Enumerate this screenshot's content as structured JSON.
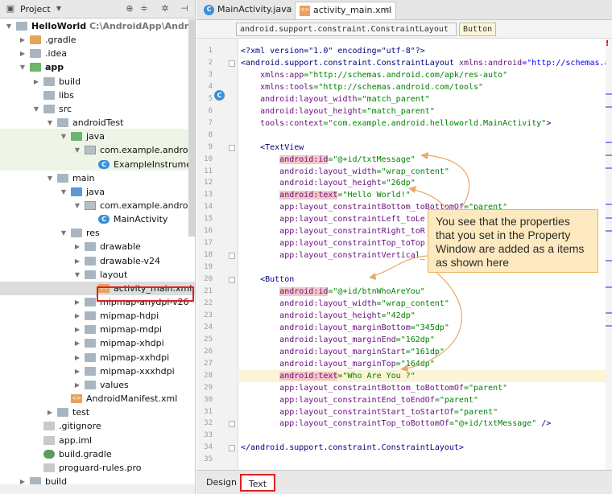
{
  "project_panel": {
    "view_label": "Project",
    "tree": [
      {
        "label": "HelloWorld",
        "path": "C:\\AndroidApp\\AndroidStudioP",
        "bold": true,
        "icon": "folder-icon",
        "color": "plain",
        "depth": 0,
        "expanded": true
      },
      {
        "label": ".gradle",
        "icon": "folder-icon",
        "color": "orange",
        "depth": 1,
        "expanded": false
      },
      {
        "label": ".idea",
        "icon": "folder-icon",
        "color": "plain",
        "depth": 1,
        "expanded": false
      },
      {
        "label": "app",
        "bold": true,
        "icon": "module-folder-icon",
        "color": "green",
        "depth": 1,
        "expanded": true
      },
      {
        "label": "build",
        "icon": "folder-icon",
        "color": "plain",
        "depth": 2,
        "expanded": false
      },
      {
        "label": "libs",
        "icon": "folder-icon",
        "color": "plain",
        "depth": 2,
        "leaf": true
      },
      {
        "label": "src",
        "icon": "folder-icon",
        "color": "plain",
        "depth": 2,
        "expanded": true
      },
      {
        "label": "androidTest",
        "icon": "folder-icon",
        "color": "plain",
        "depth": 3,
        "expanded": true
      },
      {
        "label": "java",
        "icon": "folder-icon",
        "color": "green",
        "depth": 4,
        "expanded": true
      },
      {
        "label": "com.example.android.hell",
        "icon": "package-icon",
        "depth": 5,
        "expanded": true
      },
      {
        "label": "ExampleInstrument",
        "icon": "class-icon",
        "depth": 6,
        "leaf": true
      },
      {
        "label": "main",
        "icon": "folder-icon",
        "color": "plain",
        "depth": 3,
        "expanded": true
      },
      {
        "label": "java",
        "icon": "folder-icon",
        "color": "blue",
        "depth": 4,
        "expanded": true
      },
      {
        "label": "com.example.android.hell",
        "icon": "package-icon",
        "depth": 5,
        "expanded": true
      },
      {
        "label": "MainActivity",
        "icon": "class-icon",
        "depth": 6,
        "leaf": true
      },
      {
        "label": "res",
        "icon": "folder-icon",
        "color": "plain",
        "depth": 4,
        "expanded": true
      },
      {
        "label": "drawable",
        "icon": "folder-icon",
        "color": "plain",
        "depth": 5,
        "expanded": false
      },
      {
        "label": "drawable-v24",
        "icon": "folder-icon",
        "color": "plain",
        "depth": 5,
        "expanded": false
      },
      {
        "label": "layout",
        "icon": "folder-icon",
        "color": "plain",
        "depth": 5,
        "expanded": true
      },
      {
        "label": "activity_main.xml",
        "icon": "xml-file-icon",
        "depth": 6,
        "leaf": true,
        "selected": true
      },
      {
        "label": "mipmap-anydpi-v26",
        "icon": "folder-icon",
        "color": "plain",
        "depth": 5,
        "expanded": false
      },
      {
        "label": "mipmap-hdpi",
        "icon": "folder-icon",
        "color": "plain",
        "depth": 5,
        "expanded": false
      },
      {
        "label": "mipmap-mdpi",
        "icon": "folder-icon",
        "color": "plain",
        "depth": 5,
        "expanded": false
      },
      {
        "label": "mipmap-xhdpi",
        "icon": "folder-icon",
        "color": "plain",
        "depth": 5,
        "expanded": false
      },
      {
        "label": "mipmap-xxhdpi",
        "icon": "folder-icon",
        "color": "plain",
        "depth": 5,
        "expanded": false
      },
      {
        "label": "mipmap-xxxhdpi",
        "icon": "folder-icon",
        "color": "plain",
        "depth": 5,
        "expanded": false
      },
      {
        "label": "values",
        "icon": "folder-icon",
        "color": "plain",
        "depth": 5,
        "expanded": false
      },
      {
        "label": "AndroidManifest.xml",
        "icon": "manifest-file-icon",
        "depth": 4,
        "leaf": true
      },
      {
        "label": "test",
        "icon": "folder-icon",
        "color": "plain",
        "depth": 3,
        "expanded": false
      },
      {
        "label": ".gitignore",
        "icon": "file-icon",
        "depth": 2,
        "leaf": true
      },
      {
        "label": "app.iml",
        "icon": "file-icon",
        "depth": 2,
        "leaf": true
      },
      {
        "label": "build.gradle",
        "icon": "gradle-file-icon",
        "depth": 2,
        "leaf": true
      },
      {
        "label": "proguard-rules.pro",
        "icon": "file-icon",
        "depth": 2,
        "leaf": true
      },
      {
        "label": "build",
        "icon": "folder-icon",
        "color": "plain",
        "depth": 1,
        "expanded": false
      }
    ]
  },
  "editor": {
    "tabs": [
      {
        "label": "MainActivity.java",
        "icon": "class-icon",
        "active": false
      },
      {
        "label": "activity_main.xml",
        "icon": "xml-file-icon",
        "active": true
      }
    ],
    "breadcrumbs": [
      "android.support.constraint.ConstraintLayout",
      "Button"
    ],
    "line_numbers": [
      "1",
      "2",
      "3",
      "4",
      "5",
      "6",
      "7",
      "8",
      "9",
      "10",
      "11",
      "12",
      "13",
      "14",
      "15",
      "16",
      "17",
      "18",
      "19",
      "20",
      "21",
      "22",
      "23",
      "24",
      "25",
      "26",
      "27",
      "28",
      "29",
      "30",
      "31",
      "32",
      "33",
      "34",
      "35"
    ],
    "code_lines": [
      [
        [
          "pi",
          "<?xml version=\"1.0\" encoding=\"utf-8\"?>"
        ]
      ],
      [
        [
          "tag",
          "<android.support.constraint.ConstraintLayout "
        ],
        [
          "ns",
          "xmlns:android"
        ],
        [
          "attr",
          "=\"http://schemas.a"
        ]
      ],
      [
        [
          "",
          "    "
        ],
        [
          "ns",
          "xmlns:app"
        ],
        [
          "val",
          "=\"http://schemas.android.com/apk/res-auto\""
        ]
      ],
      [
        [
          "",
          "    "
        ],
        [
          "ns",
          "xmlns:tools"
        ],
        [
          "val",
          "=\"http://schemas.android.com/tools\""
        ]
      ],
      [
        [
          "",
          "    "
        ],
        [
          "ns",
          "android:layout_width"
        ],
        [
          "val",
          "=\"match_parent\""
        ]
      ],
      [
        [
          "",
          "    "
        ],
        [
          "ns",
          "android:layout_height"
        ],
        [
          "val",
          "=\"match_parent\""
        ]
      ],
      [
        [
          "",
          "    "
        ],
        [
          "ns",
          "tools:context"
        ],
        [
          "val",
          "=\"com.example.android.helloworld.MainActivity\""
        ],
        [
          "tag",
          ">"
        ]
      ],
      [
        [
          "",
          ""
        ]
      ],
      [
        [
          "",
          "    "
        ],
        [
          "tag",
          "<TextView"
        ]
      ],
      [
        [
          "",
          "        "
        ],
        [
          "hl",
          "android:id"
        ],
        [
          "val",
          "=\"@+id/txtMessage\""
        ]
      ],
      [
        [
          "",
          "        "
        ],
        [
          "ns",
          "android:layout_width"
        ],
        [
          "val",
          "=\"wrap_content\""
        ]
      ],
      [
        [
          "",
          "        "
        ],
        [
          "ns",
          "android:layout_height"
        ],
        [
          "val",
          "=\"26dp\""
        ]
      ],
      [
        [
          "",
          "        "
        ],
        [
          "hl",
          "android:text"
        ],
        [
          "val",
          "=\"Hello World!\""
        ]
      ],
      [
        [
          "",
          "        "
        ],
        [
          "ns",
          "app:layout_constraintBottom_toBottomOf"
        ],
        [
          "val",
          "=\"parent\""
        ]
      ],
      [
        [
          "",
          "        "
        ],
        [
          "ns",
          "app:layout_constraintLeft_toLe"
        ]
      ],
      [
        [
          "",
          "        "
        ],
        [
          "ns",
          "app:layout_constraintRight_toR"
        ]
      ],
      [
        [
          "",
          "        "
        ],
        [
          "ns",
          "app:layout_constraintTop_toTop"
        ]
      ],
      [
        [
          "",
          "        "
        ],
        [
          "ns",
          "app:layout_constraintVertical_"
        ]
      ],
      [
        [
          "",
          ""
        ]
      ],
      [
        [
          "",
          "    "
        ],
        [
          "tag",
          "<Button"
        ]
      ],
      [
        [
          "",
          "        "
        ],
        [
          "hl",
          "android:id"
        ],
        [
          "val",
          "=\"@+id/btnWhoAreYou\""
        ]
      ],
      [
        [
          "",
          "        "
        ],
        [
          "ns",
          "android:layout_width"
        ],
        [
          "val",
          "=\"wrap_content\""
        ]
      ],
      [
        [
          "",
          "        "
        ],
        [
          "ns",
          "android:layout_height"
        ],
        [
          "val",
          "=\"42dp\""
        ]
      ],
      [
        [
          "",
          "        "
        ],
        [
          "ns",
          "android:layout_marginBottom"
        ],
        [
          "val",
          "=\"345dp\""
        ]
      ],
      [
        [
          "",
          "        "
        ],
        [
          "ns",
          "android:layout_marginEnd"
        ],
        [
          "val",
          "=\"162dp\""
        ]
      ],
      [
        [
          "",
          "        "
        ],
        [
          "ns",
          "android:layout_marginStart"
        ],
        [
          "val",
          "=\"161dp\""
        ]
      ],
      [
        [
          "",
          "        "
        ],
        [
          "ns",
          "android:layout_marginTop"
        ],
        [
          "val",
          "=\"164dp\""
        ]
      ],
      [
        [
          "",
          "        "
        ],
        [
          "hl",
          "android:text"
        ],
        [
          "val",
          "=\"Who Are You ?\""
        ]
      ],
      [
        [
          "",
          "        "
        ],
        [
          "ns",
          "app:layout_constraintBottom_toBottomOf"
        ],
        [
          "val",
          "=\"parent\""
        ]
      ],
      [
        [
          "",
          "        "
        ],
        [
          "ns",
          "app:layout_constraintEnd_toEndOf"
        ],
        [
          "val",
          "=\"parent\""
        ]
      ],
      [
        [
          "",
          "        "
        ],
        [
          "ns",
          "app:layout_constraintStart_toStartOf"
        ],
        [
          "val",
          "=\"parent\""
        ]
      ],
      [
        [
          "",
          "        "
        ],
        [
          "ns",
          "app:layout_constraintTop_toBottomOf"
        ],
        [
          "val",
          "=\"@+id/txtMessage\""
        ],
        [
          "tag",
          " />"
        ]
      ],
      [
        [
          "",
          ""
        ]
      ],
      [
        [
          "tag",
          "</android.support.constraint.ConstraintLayout>"
        ]
      ],
      [
        [
          "",
          ""
        ]
      ]
    ],
    "highlighted_line": 28,
    "bottom_tabs": [
      {
        "label": "Design",
        "active": false
      },
      {
        "label": "Text",
        "active": true
      }
    ]
  },
  "callout": {
    "text": "You see that the properties that you set in the Property Window are added as a items as shown here"
  },
  "colors": {
    "highlight_red": "#e02020",
    "callout_bg": "#fde9bf",
    "attr_highlight": "#f4c7c7",
    "current_line": "#fbf4d5"
  }
}
